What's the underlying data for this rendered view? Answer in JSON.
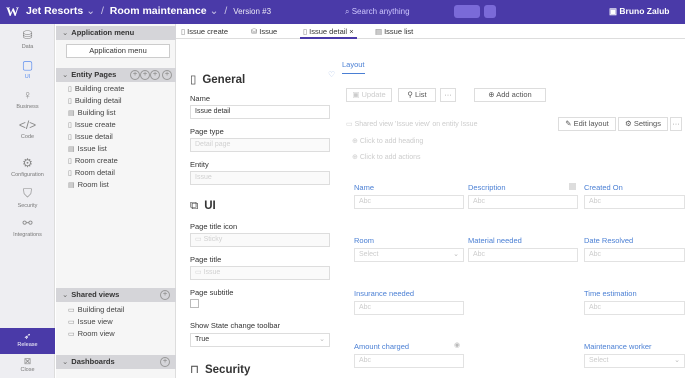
{
  "topbar": {
    "logo": "W",
    "crumbs": [
      "Jet Resorts",
      "Room maintenance",
      "Version #3"
    ],
    "search_placeholder": "Search anything",
    "user": "Bruno Zalub"
  },
  "rail": {
    "items": [
      {
        "label": "Data",
        "icon": "database-icon"
      },
      {
        "label": "UI",
        "icon": "window-icon"
      },
      {
        "label": "Business",
        "icon": "lightbulb-icon"
      },
      {
        "label": "Code",
        "icon": "code-icon"
      },
      {
        "label": "Configuration",
        "icon": "cogs-icon"
      },
      {
        "label": "Security",
        "icon": "shield-icon"
      },
      {
        "label": "Integrations",
        "icon": "network-icon"
      }
    ],
    "release": "Release",
    "close": "Close"
  },
  "panel": {
    "app_menu_header": "Application menu",
    "app_menu_button": "Application menu",
    "entity_pages_header": "Entity Pages",
    "entity_pages": [
      "Building create",
      "Building detail",
      "Building list",
      "Issue create",
      "Issue detail",
      "Issue list",
      "Room create",
      "Room detail",
      "Room list"
    ],
    "shared_views_header": "Shared views",
    "shared_views": [
      "Building detail",
      "Issue view",
      "Room view"
    ],
    "dashboards_header": "Dashboards"
  },
  "tabs": [
    {
      "label": "Issue create"
    },
    {
      "label": "Issue"
    },
    {
      "label": "Issue detail"
    },
    {
      "label": "Issue list"
    }
  ],
  "form": {
    "general_title": "General",
    "name_label": "Name",
    "name_value": "Issue detail",
    "page_type_label": "Page type",
    "page_type_value": "Detail page",
    "entity_label": "Entity",
    "entity_value": "Issue",
    "ui_title": "UI",
    "page_title_icon_label": "Page title icon",
    "page_title_icon_value": "Sticky",
    "page_title_label": "Page title",
    "page_title_value": "Issue",
    "page_subtitle_label": "Page subtitle",
    "show_state_label": "Show State change toolbar",
    "show_state_value": "True",
    "security_title": "Security"
  },
  "layout": {
    "tab_label": "Layout",
    "update_btn": "Update",
    "list_btn": "List",
    "more_btn": "···",
    "add_action_btn": "Add action",
    "shared_view_text": "Shared view 'Issue view' on entity Issue",
    "edit_layout_btn": "Edit layout",
    "settings_btn": "Settings",
    "add_heading_text": "Click to add heading",
    "add_actions_text": "Click to add actions",
    "fields": [
      {
        "label": "Name",
        "placeholder": "Abc"
      },
      {
        "label": "Description",
        "placeholder": "Abc"
      },
      {
        "label": "Created On",
        "placeholder": "Abc"
      },
      {
        "label": "Room",
        "placeholder": "Select"
      },
      {
        "label": "Material needed",
        "placeholder": "Abc"
      },
      {
        "label": "Date Resolved",
        "placeholder": "Abc"
      },
      {
        "label": "Insurance needed",
        "placeholder": "Abc"
      },
      {
        "label": "Time estimation",
        "placeholder": "Abc"
      },
      {
        "label": "Amount charged",
        "placeholder": "Abc"
      },
      {
        "label": "Maintenance worker",
        "placeholder": "Select"
      }
    ]
  }
}
